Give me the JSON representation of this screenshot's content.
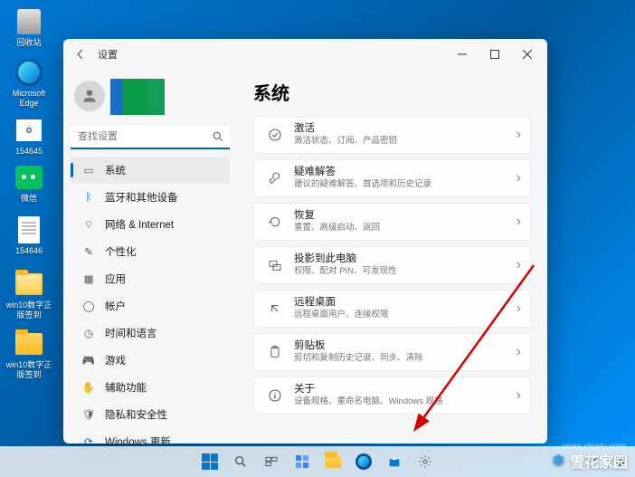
{
  "desktop_icons": {
    "recycle": "回收站",
    "edge": "Microsoft Edge",
    "i154645a": "154645",
    "wechat": "微信",
    "i154646": "154646",
    "folder1_l1": "win10数字正",
    "folder1_l2": "版签到",
    "folder2_l1": "win10数字正",
    "folder2_l2": "版签到"
  },
  "window": {
    "title": "设置",
    "back_label": "←"
  },
  "search": {
    "placeholder": "查找设置"
  },
  "nav": {
    "items": [
      "系统",
      "蓝牙和其他设备",
      "网络 & Internet",
      "个性化",
      "应用",
      "帐户",
      "时间和语言",
      "游戏",
      "辅助功能",
      "隐私和安全性",
      "Windows 更新"
    ]
  },
  "content": {
    "heading": "系统",
    "cards": [
      {
        "icon": "check-circle",
        "title": "激活",
        "sub": "激活状态、订阅、产品密钥"
      },
      {
        "icon": "wrench",
        "title": "疑难解答",
        "sub": "建议的疑难解答、首选项和历史记录"
      },
      {
        "icon": "recover",
        "title": "恢复",
        "sub": "重置、高级启动、返回"
      },
      {
        "icon": "project",
        "title": "投影到此电脑",
        "sub": "权限、配对 PIN、可发现性"
      },
      {
        "icon": "remote",
        "title": "远程桌面",
        "sub": "远程桌面用户、连接权限"
      },
      {
        "icon": "clipboard",
        "title": "剪贴板",
        "sub": "剪切和复制历史记录、同步、清除"
      },
      {
        "icon": "info",
        "title": "关于",
        "sub": "设备规格、重命名电脑、Windows 规格"
      }
    ]
  },
  "taskbar": {
    "time": "",
    "items": [
      "start",
      "search",
      "taskview",
      "widgets",
      "explorer",
      "edge",
      "store",
      "settings"
    ]
  },
  "watermarks": {
    "brand": "雪花家园",
    "url": "www.xhjaty.com"
  }
}
